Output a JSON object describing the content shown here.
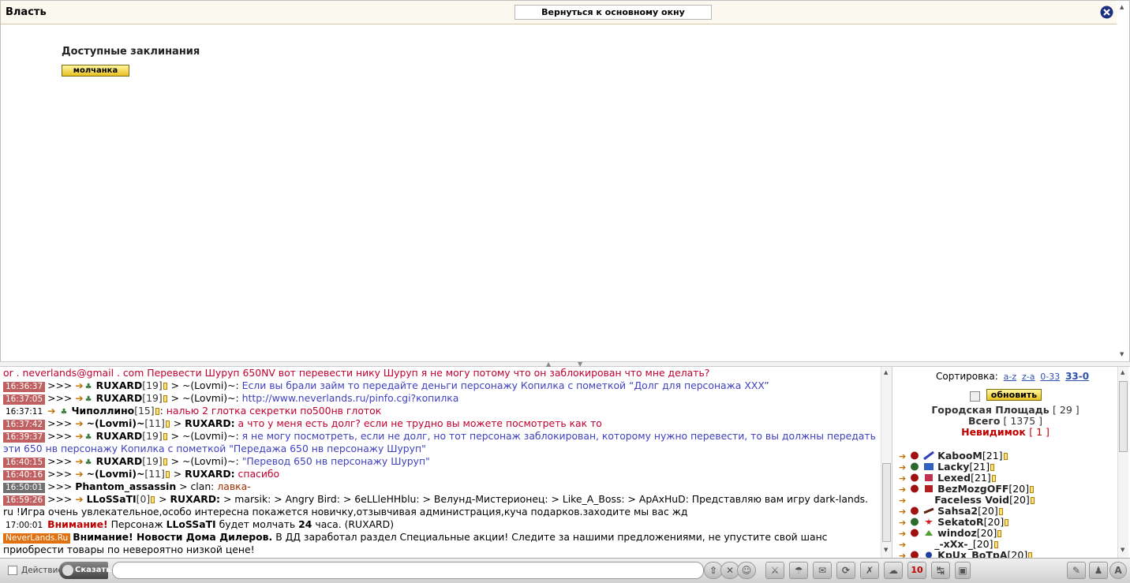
{
  "top": {
    "title": "Власть",
    "back_button": "Вернуться к основному окну",
    "spells_title": "Доступные заклинания",
    "spell_button": "молчанка"
  },
  "chat": {
    "messages": [
      {
        "line": "or . neverlands@gmail . com Перевести Шуруп 650NV вот перевести нику Шуруп я не могу потому что он заблокирован что мне делать?"
      },
      {
        "time": "16:36:37",
        "prefix": ">>>",
        "nick": "RUXARD",
        "lvl": "[19]",
        "to": "> ~(Lovmi)~:",
        "text": "Если вы брали займ то передайте деньги персонажу Копилка с пометкой “Долг для персонажа XXX”"
      },
      {
        "time": "16:37:05",
        "prefix": ">>>",
        "nick": "RUXARD",
        "lvl": "[19]",
        "to": "> ~(Lovmi)~:",
        "text": "http://www.neverlands.ru/pinfo.cgi?копилка"
      },
      {
        "time": "16:37:11",
        "nick": "Чиполлино",
        "lvl": "[15]",
        "to": ":",
        "text": "налью 2 глотка секретки по500нв глоток"
      },
      {
        "time": "16:37:42",
        "prefix": ">>>",
        "nick": "~(Lovmi)~",
        "lvl": "[11]",
        "to": "RUXARD:",
        "text": "а что у меня есть долг? если не трудно вы можете посмотреть как то"
      },
      {
        "time": "16:39:37",
        "prefix": ">>>",
        "nick": "RUXARD",
        "lvl": "[19]",
        "to": "> ~(Lovmi)~:",
        "text": "я не могу посмотреть, если не долг, но тот персонаж заблокирован, которому нужно перевести, то вы должны передать эти 650 нв персонажу Копилка с пометкой \"Передажа 650 нв персонажу Шуруп\""
      },
      {
        "time": "16:40:15",
        "prefix": ">>>",
        "nick": "RUXARD",
        "lvl": "[19]",
        "to": "> ~(Lovmi)~:",
        "text": "\"Перевод 650 нв персонажу Шуруп\""
      },
      {
        "time": "16:40:16",
        "prefix": ">>>",
        "nick": "~(Lovmi)~",
        "lvl": "[11]",
        "to": "RUXARD:",
        "text": "спасибо"
      },
      {
        "time": "16:50:01",
        "prefix": ">>>",
        "nick": "Phantom_assassin",
        "to": "> clan:",
        "text": "лавка-"
      },
      {
        "time": "16:59:26",
        "prefix": ">>>",
        "nick": "LLoSSaTI",
        "lvl": "[0]",
        "to": "RUXARD:",
        "text": "> marsik: > Angry Bird: > 6eLLleHHblu: > Велунд-Мистерионец: > Like_A_Boss: > ApAxHuD: Представляю вам игру dark-lands. ru !Игра очень увлекательное,особо интересна покажется новичку,отзывчивая администрация,куча подарков.заходите мы вас жд"
      },
      {
        "time": "17:00:01",
        "warn": "Внимание!",
        "text1": "Персонаж",
        "nick": "LLoSSaTI",
        "text2": "будет молчать",
        "num": "24",
        "text3": "часа. (RUXARD)"
      },
      {
        "badge": "NeverLands.Ru",
        "bold": "Внимание! Новости Дома Дилеров.",
        "text": "В ДД заработал раздел Специальные акции! Следите за нашими предложениями, не упустите свой шанс приобрести товары по невероятно низкой цене!"
      }
    ]
  },
  "players": {
    "sort_label": "Сортировка:",
    "sort_links": [
      "a-z",
      "z-a",
      "0-33",
      "33-0"
    ],
    "refresh_button": "обновить",
    "location": "Городская Площадь",
    "location_count": "[ 29 ]",
    "total_label": "Всего",
    "total_count": "[ 1375 ]",
    "invis_label": "Невидимок",
    "invis_count": "[ 1 ]",
    "list": [
      {
        "name": "KabooM",
        "lvl": "[21]"
      },
      {
        "name": "Lacky",
        "lvl": "[21]"
      },
      {
        "name": "Lexed",
        "lvl": "[21]"
      },
      {
        "name": "BezMozgOFF",
        "lvl": "[20]"
      },
      {
        "name": "Faceless Void",
        "lvl": "[20]"
      },
      {
        "name": "Sahsa2",
        "lvl": "[20]"
      },
      {
        "name": "SekatoR",
        "lvl": "[20]"
      },
      {
        "name": "windoz",
        "lvl": "[20]"
      },
      {
        "name": "_-xXx-_",
        "lvl": "[20]"
      },
      {
        "name": "KpUx_BoTpA",
        "lvl": "[20]"
      }
    ]
  },
  "toolbar": {
    "action_label": "Действие",
    "say_button": "Сказать:",
    "timer_label": "10"
  }
}
